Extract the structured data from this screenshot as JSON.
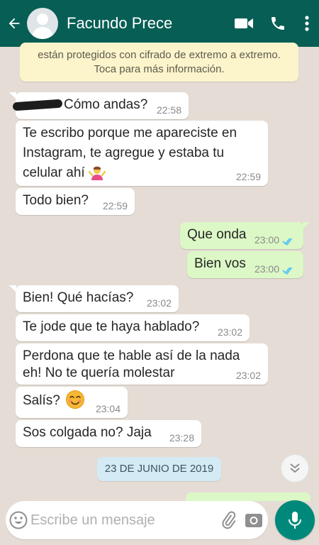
{
  "header": {
    "contact_name": "Facundo Prece"
  },
  "notice": {
    "line1": "están protegidos con cifrado de extremo a extremo.",
    "line2": "Toca para más información."
  },
  "messages": [
    {
      "dir": "in",
      "text": "Cómo andas?",
      "time": "22:58"
    },
    {
      "dir": "in",
      "line1": "Te escribo porque me apareciste en",
      "line2": "Instagram, te agregue y estaba tu",
      "line3": "celular ahí",
      "time": "22:59"
    },
    {
      "dir": "in",
      "text": "Todo bien?",
      "time": "22:59"
    },
    {
      "dir": "out",
      "text": "Que onda",
      "time": "23:00"
    },
    {
      "dir": "out",
      "text": "Bien vos",
      "time": "23:00"
    },
    {
      "dir": "in",
      "text": "Bien! Qué hacías?",
      "time": "23:02"
    },
    {
      "dir": "in",
      "text": "Te jode que te haya hablado?",
      "time": "23:02"
    },
    {
      "dir": "in",
      "line1": "Perdona que te hable así de la nada",
      "line2": "eh! No te quería molestar",
      "time": "23:02"
    },
    {
      "dir": "in",
      "text": "Salís?",
      "time": "23:04"
    },
    {
      "dir": "in",
      "text": "Sos colgada no? Jaja",
      "time": "23:28"
    }
  ],
  "date_chip": "23 DE JUNIO DE 2019",
  "composer": {
    "placeholder": "Escribe un mensaje"
  },
  "icons": {
    "back": "arrow-left-icon",
    "video": "video-call-icon",
    "call": "phone-icon",
    "menu": "more-vert-icon",
    "emoji": "emoji-icon",
    "attach": "paperclip-icon",
    "camera": "camera-icon",
    "mic": "mic-icon",
    "scroll": "double-chevron-down-icon"
  },
  "colors": {
    "header": "#075e54",
    "outgoing_bubble": "#dcf8c6",
    "incoming_bubble": "#ffffff",
    "read_ticks": "#4fc3f7",
    "mic_button": "#00897b"
  }
}
